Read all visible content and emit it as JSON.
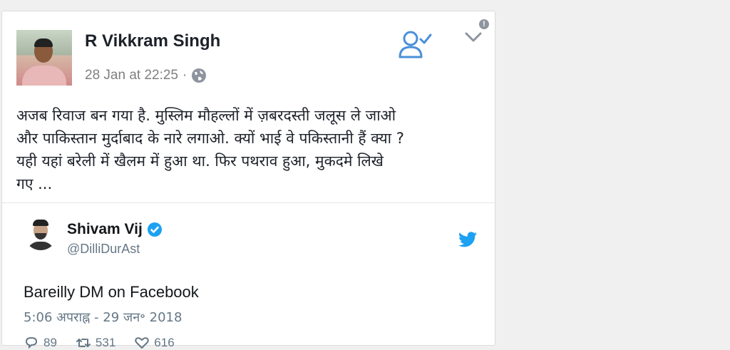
{
  "facebook_post": {
    "author": "R Vikkram Singh",
    "timestamp": "28 Jan at 22:25",
    "separator": "·",
    "text": "अजब रिवाज बन गया है. मुस्लिम मौहल्लों में ज़बरदस्ती जलूस ले जाओ\nऔर पाकिस्तान मुर्दाबाद के नारे लगाओ. क्यों भाई वे पकिस्तानी हैं क्या ?\nयही यहां बरेली में खैलम में हुआ था. फिर पथराव हुआ, मुकदमे लिखे\nगए ...",
    "info_glyph": "!",
    "icons": [
      "globe-icon",
      "follow-icon",
      "chevron-down-icon",
      "info-icon"
    ]
  },
  "tweet": {
    "name": "Shivam Vij",
    "handle": "@DilliDurAst",
    "text": "Bareilly DM on Facebook",
    "timestamp": "5:06 अपराह्न - 29 जन॰ 2018",
    "replies": "89",
    "retweets": "531",
    "likes": "616",
    "icons": [
      "verified-icon",
      "twitter-bird-icon",
      "reply-icon",
      "retweet-icon",
      "like-icon"
    ]
  },
  "colors": {
    "facebook_blue": "#4a90d9",
    "twitter_blue": "#1da1f2"
  }
}
